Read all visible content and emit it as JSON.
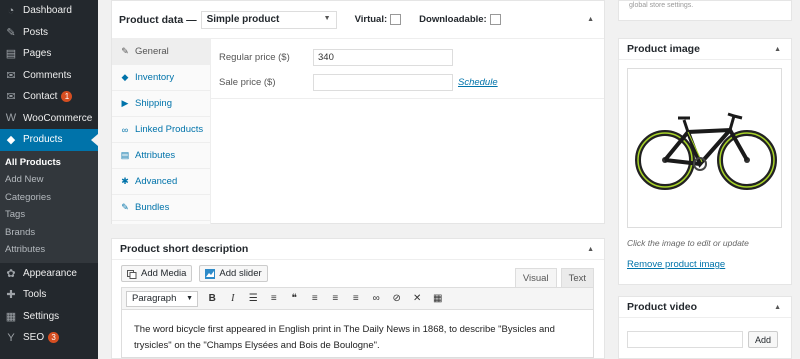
{
  "admin_menu": {
    "items": [
      {
        "label": "Dashboard",
        "icon": "dashboard-icon",
        "glyph": "◔"
      },
      {
        "label": "Posts",
        "icon": "pin-icon",
        "glyph": "✎"
      },
      {
        "label": "Pages",
        "icon": "pages-icon",
        "glyph": "▤"
      },
      {
        "label": "Comments",
        "icon": "comment-icon",
        "glyph": "✉"
      },
      {
        "label": "Contact",
        "icon": "mail-icon",
        "glyph": "✉",
        "badge": "1"
      },
      {
        "label": "WooCommerce",
        "icon": "woo-icon",
        "glyph": "W"
      },
      {
        "label": "Products",
        "icon": "products-icon",
        "glyph": "◆",
        "active": true
      }
    ],
    "submenu": [
      "All Products",
      "Add New",
      "Categories",
      "Tags",
      "Brands",
      "Attributes"
    ],
    "items_after": [
      {
        "label": "Appearance",
        "icon": "appearance-icon",
        "glyph": "✿"
      },
      {
        "label": "Tools",
        "icon": "tools-icon",
        "glyph": "✚"
      },
      {
        "label": "Settings",
        "icon": "settings-icon",
        "glyph": "▦"
      },
      {
        "label": "SEO",
        "icon": "seo-icon",
        "glyph": "Y",
        "badge": "3"
      }
    ]
  },
  "product_data": {
    "title": "Product data —",
    "type_value": "Simple product",
    "virtual_label": "Virtual:",
    "downloadable_label": "Downloadable:",
    "tabs": [
      {
        "label": "General",
        "icon": "wrench-icon",
        "glyph": "✎"
      },
      {
        "label": "Inventory",
        "icon": "tag-icon",
        "glyph": "◆"
      },
      {
        "label": "Shipping",
        "icon": "truck-icon",
        "glyph": "▶"
      },
      {
        "label": "Linked Products",
        "icon": "link-icon",
        "glyph": "∞"
      },
      {
        "label": "Attributes",
        "icon": "list-icon",
        "glyph": "▤"
      },
      {
        "label": "Advanced",
        "icon": "gear-icon",
        "glyph": "✱"
      },
      {
        "label": "Bundles",
        "icon": "wrench-icon",
        "glyph": "✎"
      }
    ],
    "regular_price_label": "Regular price ($)",
    "regular_price_value": "340",
    "sale_price_label": "Sale price ($)",
    "sale_price_value": "",
    "schedule_label": "Schedule"
  },
  "short_description": {
    "title": "Product short description",
    "add_media_label": "Add Media",
    "add_slider_label": "Add slider",
    "tab_visual": "Visual",
    "tab_text": "Text",
    "format_value": "Paragraph",
    "toolbar": [
      {
        "icon": "bold-icon",
        "glyph": "B"
      },
      {
        "icon": "italic-icon",
        "glyph": "I"
      },
      {
        "icon": "bullet-list-icon",
        "glyph": "☰"
      },
      {
        "icon": "numbered-list-icon",
        "glyph": "≡"
      },
      {
        "icon": "blockquote-icon",
        "glyph": "❝"
      },
      {
        "icon": "align-left-icon",
        "glyph": "≡"
      },
      {
        "icon": "align-center-icon",
        "glyph": "≡"
      },
      {
        "icon": "align-right-icon",
        "glyph": "≡"
      },
      {
        "icon": "link-icon",
        "glyph": "∞"
      },
      {
        "icon": "unlink-icon",
        "glyph": "⊘"
      },
      {
        "icon": "fullscreen-icon",
        "glyph": "✕"
      },
      {
        "icon": "kitchen-sink-icon",
        "glyph": "▦"
      }
    ],
    "content": "The word bicycle first appeared in English print in The Daily News in 1868, to describe \"Bysicles and trysicles\" on the \"Champs Elysées and Bois de Boulogne\"."
  },
  "sidebar_right": {
    "publish_text": "global store settings.",
    "product_image_title": "Product image",
    "image_caption": "Click the image to edit or update",
    "remove_label": "Remove product image",
    "product_video_title": "Product video",
    "video_add_label": "Add"
  }
}
